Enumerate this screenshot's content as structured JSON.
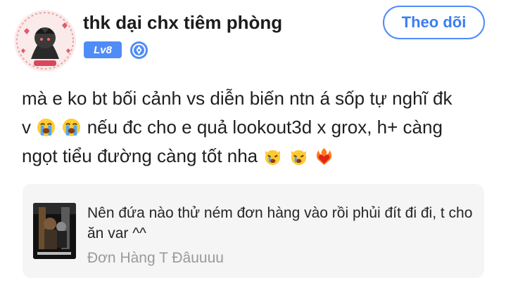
{
  "author": {
    "name": "thk dại chx tiêm phòng",
    "level": "Lv8",
    "follow_label": "Theo dõi"
  },
  "post": {
    "line1": "mà e ko bt bối cảnh vs diễn biến ntn á sốp tự nghĩ đk",
    "line2_prefix": "v",
    "line2_suffix": "nếu đc cho e quả lookout3d x grox, h+ càng",
    "line3": "ngọt tiểu đường càng tốt nha",
    "emojis": [
      "loudly-crying-face",
      "loudly-crying-face",
      "weary-cat",
      "weary-cat",
      "heart-on-fire"
    ]
  },
  "quoted": {
    "text": "Nên đứa nào thử ném đơn hàng vào rồi phủi đít đi đi, t cho ăn var ^^",
    "source": "Đơn Hàng T Đâuuuu"
  },
  "colors": {
    "accent": "#4f8cf7",
    "quote_bg": "#f5f5f5",
    "muted_text": "#9a9a9a"
  }
}
